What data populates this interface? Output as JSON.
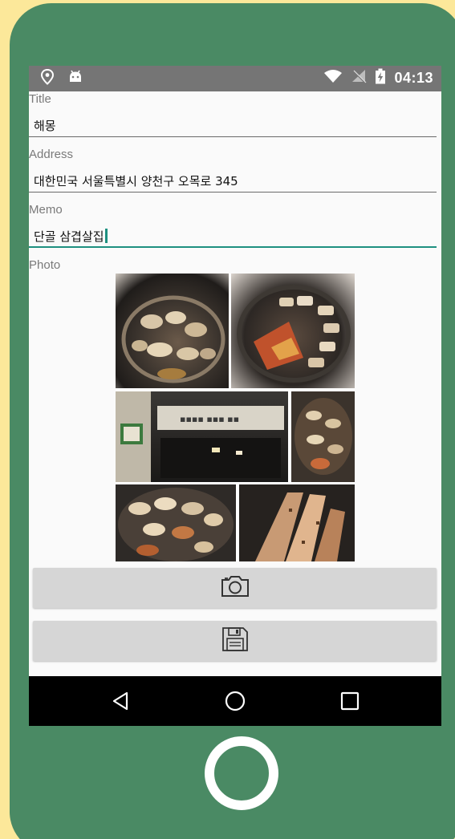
{
  "status_bar": {
    "time": "04:13",
    "icons": [
      "location-icon",
      "android-icon",
      "wifi-icon",
      "no-signal-icon",
      "battery-charging-icon"
    ]
  },
  "form": {
    "title": {
      "label": "Title",
      "value": "해몽"
    },
    "address": {
      "label": "Address",
      "value": "대한민국 서울특별시 양천구 오목로 345"
    },
    "memo": {
      "label": "Memo",
      "value": "단골 삼겹살집"
    },
    "photo": {
      "label": "Photo",
      "description": "food-photo-collage"
    }
  },
  "buttons": {
    "camera": {
      "icon": "camera-icon"
    },
    "save": {
      "icon": "floppy-disk-icon"
    }
  },
  "nav": {
    "icons": [
      "back-icon",
      "home-icon",
      "recents-icon"
    ]
  },
  "colors": {
    "background": "#fce89a",
    "device": "#4a8a64",
    "status_bar": "#757575",
    "accent": "#1e9080",
    "button": "#d6d6d6"
  }
}
